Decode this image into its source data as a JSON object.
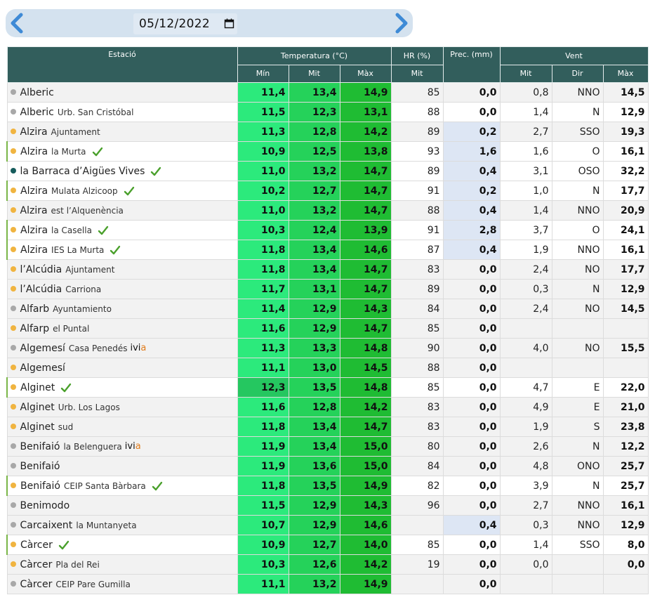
{
  "toolbar": {
    "date": "05/12/2022",
    "prev_icon": "chevron-left-icon",
    "next_icon": "chevron-right-icon",
    "calendar_icon": "calendar-icon"
  },
  "headers": {
    "station": "Estació",
    "temperature": "Temperatura (°C)",
    "hr": "HR (%)",
    "prec": "Prec. (mm)",
    "wind": "Vent",
    "t_min": "Mín",
    "t_mit": "Mit",
    "t_max": "Màx",
    "hr_mit": "Mit",
    "w_mit": "Mit",
    "w_dir": "Dir",
    "w_max": "Màx"
  },
  "colors": {
    "header_bg": "#325e5c",
    "t_min_bg": "#2cea7c",
    "t_mit_bg": "#25d25a",
    "t_max_bg": "#1fbc33",
    "t_min_alt_bg": "#25c760",
    "prec_bg": "#dde6f4",
    "dot_gray": "#a8a8a8",
    "dot_orange": "#f0b440",
    "dot_teal": "#165c5c",
    "accent_border": "#7ab648",
    "check": "#4aa02c",
    "ivia_accent": "#e07b1a"
  },
  "rows": [
    {
      "name": "Alberic",
      "sub": "",
      "dot": "gray",
      "check": false,
      "ivia": false,
      "accent": false,
      "bg": "#f2f2f2",
      "tmin": "11,4",
      "tmit": "13,4",
      "tmax": "14,9",
      "hr": "85",
      "prec": "0,0",
      "precHl": false,
      "wmit": "0,8",
      "wdir": "NNO",
      "wmax": "14,5"
    },
    {
      "name": "Alberic",
      "sub": "Urb. San Cristóbal",
      "dot": "gray",
      "check": false,
      "ivia": false,
      "accent": false,
      "bg": "#ffffff",
      "tmin": "11,5",
      "tmit": "12,3",
      "tmax": "13,1",
      "hr": "88",
      "prec": "0,0",
      "precHl": false,
      "wmit": "1,4",
      "wdir": "N",
      "wmax": "12,9"
    },
    {
      "name": "Alzira",
      "sub": "Ajuntament",
      "dot": "orange",
      "check": false,
      "ivia": false,
      "accent": false,
      "bg": "#f2f2f2",
      "tmin": "11,3",
      "tmit": "12,8",
      "tmax": "14,2",
      "hr": "89",
      "prec": "0,2",
      "precHl": true,
      "wmit": "2,7",
      "wdir": "SSO",
      "wmax": "19,3"
    },
    {
      "name": "Alzira",
      "sub": "la Murta",
      "dot": "orange",
      "check": true,
      "ivia": false,
      "accent": true,
      "bg": "#ffffff",
      "tmin": "10,9",
      "tmit": "12,5",
      "tmax": "13,8",
      "hr": "93",
      "prec": "1,6",
      "precHl": true,
      "wmit": "1,6",
      "wdir": "O",
      "wmax": "16,1"
    },
    {
      "name": "la Barraca d’Aigües Vives",
      "sub": "",
      "dot": "teal",
      "check": true,
      "ivia": false,
      "accent": false,
      "bg": "#ffffff",
      "tmin": "11,0",
      "tmit": "13,2",
      "tmax": "14,7",
      "hr": "89",
      "prec": "0,4",
      "precHl": true,
      "wmit": "3,1",
      "wdir": "OSO",
      "wmax": "32,2"
    },
    {
      "name": "Alzira",
      "sub": "Mulata Alzicoop",
      "dot": "orange",
      "check": true,
      "ivia": false,
      "accent": true,
      "bg": "#ffffff",
      "tmin": "10,2",
      "tmit": "12,7",
      "tmax": "14,7",
      "hr": "91",
      "prec": "0,2",
      "precHl": true,
      "wmit": "1,0",
      "wdir": "N",
      "wmax": "17,7"
    },
    {
      "name": "Alzira",
      "sub": "est l’Alquenència",
      "dot": "orange",
      "check": false,
      "ivia": false,
      "accent": false,
      "bg": "#f2f2f2",
      "tmin": "11,0",
      "tmit": "13,2",
      "tmax": "14,7",
      "hr": "88",
      "prec": "0,4",
      "precHl": true,
      "wmit": "1,4",
      "wdir": "NNO",
      "wmax": "20,9"
    },
    {
      "name": "Alzira",
      "sub": "la Casella",
      "dot": "orange",
      "check": true,
      "ivia": false,
      "accent": true,
      "bg": "#ffffff",
      "tmin": "10,3",
      "tmit": "12,4",
      "tmax": "13,9",
      "hr": "91",
      "prec": "2,8",
      "precHl": true,
      "wmit": "3,7",
      "wdir": "O",
      "wmax": "24,1"
    },
    {
      "name": "Alzira",
      "sub": "IES La Murta",
      "dot": "orange",
      "check": true,
      "ivia": false,
      "accent": true,
      "bg": "#ffffff",
      "tmin": "11,8",
      "tmit": "13,4",
      "tmax": "14,6",
      "hr": "87",
      "prec": "0,4",
      "precHl": true,
      "wmit": "1,9",
      "wdir": "NNO",
      "wmax": "16,1"
    },
    {
      "name": "l’Alcúdia",
      "sub": "Ajuntament",
      "dot": "orange",
      "check": false,
      "ivia": false,
      "accent": false,
      "bg": "#f2f2f2",
      "tmin": "11,8",
      "tmit": "13,4",
      "tmax": "14,7",
      "hr": "83",
      "prec": "0,0",
      "precHl": false,
      "wmit": "2,4",
      "wdir": "NO",
      "wmax": "17,7"
    },
    {
      "name": "l’Alcúdia",
      "sub": "Carriona",
      "dot": "orange",
      "check": false,
      "ivia": false,
      "accent": false,
      "bg": "#f2f2f2",
      "tmin": "11,7",
      "tmit": "13,1",
      "tmax": "14,7",
      "hr": "89",
      "prec": "0,0",
      "precHl": false,
      "wmit": "0,3",
      "wdir": "N",
      "wmax": "12,9"
    },
    {
      "name": "Alfarb",
      "sub": "Ayuntamiento",
      "dot": "gray",
      "check": false,
      "ivia": false,
      "accent": false,
      "bg": "#f2f2f2",
      "tmin": "11,4",
      "tmit": "12,9",
      "tmax": "14,3",
      "hr": "84",
      "prec": "0,0",
      "precHl": false,
      "wmit": "2,4",
      "wdir": "NO",
      "wmax": "14,5"
    },
    {
      "name": "Alfarp",
      "sub": "el Puntal",
      "dot": "orange",
      "check": false,
      "ivia": false,
      "accent": false,
      "bg": "#f2f2f2",
      "tmin": "11,6",
      "tmit": "12,9",
      "tmax": "14,7",
      "hr": "85",
      "prec": "0,0",
      "precHl": false,
      "wmit": "",
      "wdir": "",
      "wmax": ""
    },
    {
      "name": "Algemesí",
      "sub": "Casa Penedés",
      "dot": "gray",
      "check": false,
      "ivia": true,
      "accent": false,
      "bg": "#f2f2f2",
      "tmin": "11,3",
      "tmit": "13,3",
      "tmax": "14,8",
      "hr": "90",
      "prec": "0,0",
      "precHl": false,
      "wmit": "4,0",
      "wdir": "NO",
      "wmax": "15,5"
    },
    {
      "name": "Algemesí",
      "sub": "",
      "dot": "orange",
      "check": false,
      "ivia": false,
      "accent": false,
      "bg": "#f2f2f2",
      "tmin": "11,1",
      "tmit": "13,0",
      "tmax": "14,5",
      "hr": "88",
      "prec": "0,0",
      "precHl": false,
      "wmit": "",
      "wdir": "",
      "wmax": ""
    },
    {
      "name": "Alginet",
      "sub": "",
      "dot": "orange",
      "check": true,
      "ivia": false,
      "accent": true,
      "bg": "#ffffff",
      "tmin": "12,3",
      "tminAlt": true,
      "tmit": "13,5",
      "tmax": "14,8",
      "hr": "85",
      "prec": "0,0",
      "precHl": false,
      "wmit": "4,7",
      "wdir": "E",
      "wmax": "22,0"
    },
    {
      "name": "Alginet",
      "sub": "Urb. Los Lagos",
      "dot": "orange",
      "check": false,
      "ivia": false,
      "accent": false,
      "bg": "#f2f2f2",
      "tmin": "11,6",
      "tmit": "12,8",
      "tmax": "14,2",
      "hr": "83",
      "prec": "0,0",
      "precHl": false,
      "wmit": "4,9",
      "wdir": "E",
      "wmax": "21,0"
    },
    {
      "name": "Alginet",
      "sub": "sud",
      "dot": "orange",
      "check": false,
      "ivia": false,
      "accent": false,
      "bg": "#f2f2f2",
      "tmin": "11,8",
      "tmit": "13,4",
      "tmax": "14,7",
      "hr": "83",
      "prec": "0,0",
      "precHl": false,
      "wmit": "1,9",
      "wdir": "S",
      "wmax": "23,8"
    },
    {
      "name": "Benifaió",
      "sub": "la Belenguera",
      "dot": "gray",
      "check": false,
      "ivia": true,
      "accent": false,
      "bg": "#f2f2f2",
      "tmin": "11,9",
      "tmit": "13,4",
      "tmax": "15,0",
      "hr": "80",
      "prec": "0,0",
      "precHl": false,
      "wmit": "2,6",
      "wdir": "N",
      "wmax": "12,2"
    },
    {
      "name": "Benifaió",
      "sub": "",
      "dot": "gray",
      "check": false,
      "ivia": false,
      "accent": false,
      "bg": "#f2f2f2",
      "tmin": "11,9",
      "tmit": "13,6",
      "tmax": "15,0",
      "hr": "84",
      "prec": "0,0",
      "precHl": false,
      "wmit": "4,8",
      "wdir": "ONO",
      "wmax": "25,7"
    },
    {
      "name": "Benifaió",
      "sub": "CEIP Santa Bàrbara",
      "dot": "orange",
      "check": true,
      "ivia": false,
      "accent": true,
      "bg": "#ffffff",
      "tmin": "11,8",
      "tmit": "13,5",
      "tmax": "14,9",
      "hr": "82",
      "prec": "0,0",
      "precHl": false,
      "wmit": "3,9",
      "wdir": "N",
      "wmax": "25,7"
    },
    {
      "name": "Benimodo",
      "sub": "",
      "dot": "gray",
      "check": false,
      "ivia": false,
      "accent": false,
      "bg": "#f2f2f2",
      "tmin": "11,5",
      "tmit": "12,9",
      "tmax": "14,3",
      "hr": "96",
      "prec": "0,0",
      "precHl": false,
      "wmit": "2,7",
      "wdir": "NNO",
      "wmax": "16,1"
    },
    {
      "name": "Carcaixent",
      "sub": "la Muntanyeta",
      "dot": "gray",
      "check": false,
      "ivia": false,
      "accent": false,
      "bg": "#f2f2f2",
      "tmin": "10,7",
      "tmit": "12,9",
      "tmax": "14,6",
      "hr": "",
      "prec": "0,4",
      "precHl": true,
      "wmit": "0,3",
      "wdir": "NNO",
      "wmax": "12,9"
    },
    {
      "name": "Càrcer",
      "sub": "",
      "dot": "orange",
      "check": true,
      "ivia": false,
      "accent": true,
      "bg": "#ffffff",
      "tmin": "10,9",
      "tmit": "12,7",
      "tmax": "14,0",
      "hr": "85",
      "prec": "0,0",
      "precHl": false,
      "wmit": "1,4",
      "wdir": "SSO",
      "wmax": "8,0"
    },
    {
      "name": "Càrcer",
      "sub": "Pla del Rei",
      "dot": "orange",
      "check": false,
      "ivia": false,
      "accent": false,
      "bg": "#f2f2f2",
      "tmin": "10,3",
      "tmit": "12,6",
      "tmax": "14,2",
      "hr": "19",
      "prec": "0,0",
      "precHl": false,
      "wmit": "0,0",
      "wdir": "",
      "wmax": "0,0"
    },
    {
      "name": "Càrcer",
      "sub": "CEIP Pare Gumilla",
      "dot": "gray",
      "check": false,
      "ivia": false,
      "accent": false,
      "bg": "#f2f2f2",
      "tmin": "11,1",
      "tmit": "13,2",
      "tmax": "14,9",
      "hr": "",
      "prec": "0,0",
      "precHl": false,
      "wmit": "",
      "wdir": "",
      "wmax": ""
    }
  ],
  "ivia_label": {
    "main": "ivi",
    "accent": "a"
  }
}
